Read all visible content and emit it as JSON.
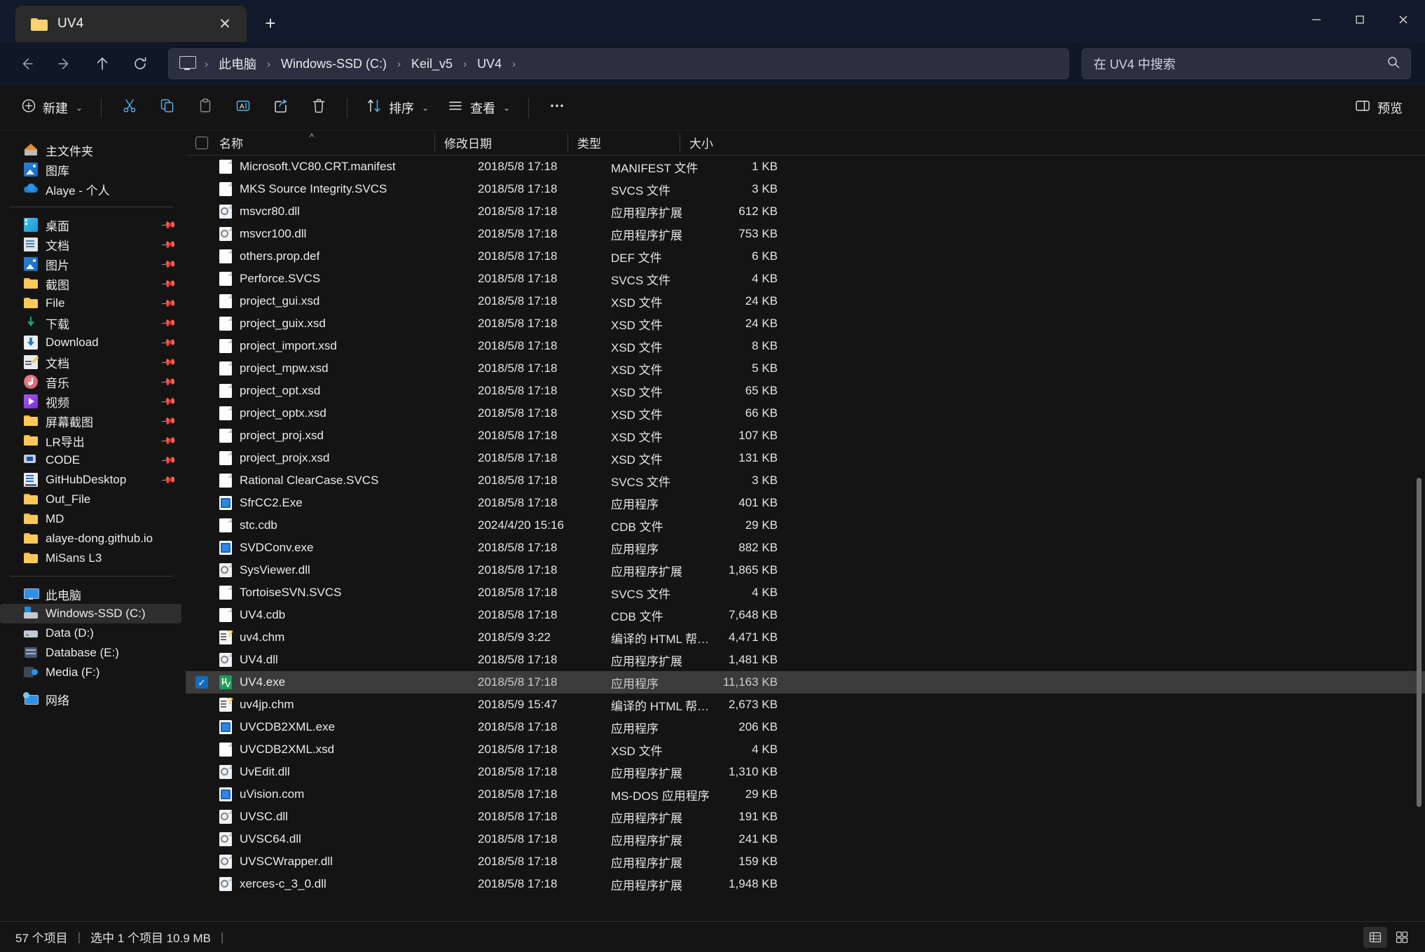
{
  "window": {
    "tab_title": "UV4",
    "tab_close_glyph": "✕",
    "new_tab_glyph": "+",
    "minimize_label": "最小化",
    "maximize_label": "最大化",
    "close_label": "关闭"
  },
  "addressbar": {
    "back_label": "返回",
    "forward_label": "前进",
    "up_label": "向上",
    "refresh_label": "刷新",
    "breadcrumbs": [
      "此电脑",
      "Windows-SSD (C:)",
      "Keil_v5",
      "UV4"
    ],
    "separator": "›",
    "search_placeholder": "在 UV4 中搜索"
  },
  "toolbar": {
    "new_label": "新建",
    "cut_label": "剪切",
    "copy_label": "复制",
    "paste_label": "粘贴",
    "rename_label": "重命名",
    "share_label": "共享",
    "delete_label": "删除",
    "sort_label": "排序",
    "view_label": "查看",
    "more_label": "查看更多",
    "preview_label": "预览",
    "chevron": "⌄"
  },
  "sidebar": {
    "groups": [
      {
        "items": [
          {
            "label": "主文件夹",
            "icon": "home-icon",
            "pinned": false
          },
          {
            "label": "图库",
            "icon": "gallery-icon",
            "pinned": false
          },
          {
            "label": "Alaye - 个人",
            "icon": "onedrive-icon",
            "pinned": false
          }
        ]
      },
      {
        "items": [
          {
            "label": "桌面",
            "icon": "desktop-icon",
            "pinned": true
          },
          {
            "label": "文档",
            "icon": "documents-icon",
            "pinned": true
          },
          {
            "label": "图片",
            "icon": "pictures-icon",
            "pinned": true
          },
          {
            "label": "截图",
            "icon": "folder-icon",
            "pinned": true
          },
          {
            "label": "File",
            "icon": "folder-icon",
            "pinned": true
          },
          {
            "label": "下载",
            "icon": "downloads-arrow-icon",
            "pinned": true
          },
          {
            "label": "Download",
            "icon": "download-box-icon",
            "pinned": true
          },
          {
            "label": "文档",
            "icon": "documents-edit-icon",
            "pinned": true
          },
          {
            "label": "音乐",
            "icon": "music-icon",
            "pinned": true
          },
          {
            "label": "视频",
            "icon": "video-icon",
            "pinned": true
          },
          {
            "label": "屏幕截图",
            "icon": "folder-icon",
            "pinned": true
          },
          {
            "label": "LR导出",
            "icon": "folder-icon",
            "pinned": true
          },
          {
            "label": "CODE",
            "icon": "code-icon",
            "pinned": true
          },
          {
            "label": "GitHubDesktop",
            "icon": "githubdesktop-icon",
            "pinned": true
          },
          {
            "label": "Out_File",
            "icon": "folder-icon",
            "pinned": false
          },
          {
            "label": "MD",
            "icon": "folder-icon",
            "pinned": false
          },
          {
            "label": "alaye-dong.github.io",
            "icon": "folder-icon",
            "pinned": false
          },
          {
            "label": "MiSans L3",
            "icon": "folder-icon",
            "pinned": false
          }
        ]
      },
      {
        "items": [
          {
            "label": "此电脑",
            "icon": "this-pc-icon",
            "pinned": false
          },
          {
            "label": "Windows-SSD (C:)",
            "icon": "windows-drive-icon",
            "pinned": false,
            "selected": true
          },
          {
            "label": "Data (D:)",
            "icon": "drive-icon",
            "pinned": false
          },
          {
            "label": "Database (E:)",
            "icon": "database-drive-icon",
            "pinned": false
          },
          {
            "label": "Media (F:)",
            "icon": "media-drive-icon",
            "pinned": false
          }
        ]
      },
      {
        "items": [
          {
            "label": "网络",
            "icon": "network-icon",
            "pinned": false
          }
        ]
      }
    ]
  },
  "filelist": {
    "columns": {
      "name": "名称",
      "date": "修改日期",
      "type": "类型",
      "size": "大小"
    },
    "sort_indicator": "^",
    "rows": [
      {
        "name": "Microsoft.VC80.CRT.manifest",
        "date": "2018/5/8 17:18",
        "type": "MANIFEST 文件",
        "size": "1 KB",
        "icon": "file-blank-icon"
      },
      {
        "name": "MKS Source Integrity.SVCS",
        "date": "2018/5/8 17:18",
        "type": "SVCS 文件",
        "size": "3 KB",
        "icon": "file-blank-icon"
      },
      {
        "name": "msvcr80.dll",
        "date": "2018/5/8 17:18",
        "type": "应用程序扩展",
        "size": "612 KB",
        "icon": "file-dll-icon"
      },
      {
        "name": "msvcr100.dll",
        "date": "2018/5/8 17:18",
        "type": "应用程序扩展",
        "size": "753 KB",
        "icon": "file-dll-icon"
      },
      {
        "name": "others.prop.def",
        "date": "2018/5/8 17:18",
        "type": "DEF 文件",
        "size": "6 KB",
        "icon": "file-blank-icon"
      },
      {
        "name": "Perforce.SVCS",
        "date": "2018/5/8 17:18",
        "type": "SVCS 文件",
        "size": "4 KB",
        "icon": "file-blank-icon"
      },
      {
        "name": "project_gui.xsd",
        "date": "2018/5/8 17:18",
        "type": "XSD 文件",
        "size": "24 KB",
        "icon": "file-blank-icon"
      },
      {
        "name": "project_guix.xsd",
        "date": "2018/5/8 17:18",
        "type": "XSD 文件",
        "size": "24 KB",
        "icon": "file-blank-icon"
      },
      {
        "name": "project_import.xsd",
        "date": "2018/5/8 17:18",
        "type": "XSD 文件",
        "size": "8 KB",
        "icon": "file-blank-icon"
      },
      {
        "name": "project_mpw.xsd",
        "date": "2018/5/8 17:18",
        "type": "XSD 文件",
        "size": "5 KB",
        "icon": "file-blank-icon"
      },
      {
        "name": "project_opt.xsd",
        "date": "2018/5/8 17:18",
        "type": "XSD 文件",
        "size": "65 KB",
        "icon": "file-blank-icon"
      },
      {
        "name": "project_optx.xsd",
        "date": "2018/5/8 17:18",
        "type": "XSD 文件",
        "size": "66 KB",
        "icon": "file-blank-icon"
      },
      {
        "name": "project_proj.xsd",
        "date": "2018/5/8 17:18",
        "type": "XSD 文件",
        "size": "107 KB",
        "icon": "file-blank-icon"
      },
      {
        "name": "project_projx.xsd",
        "date": "2018/5/8 17:18",
        "type": "XSD 文件",
        "size": "131 KB",
        "icon": "file-blank-icon"
      },
      {
        "name": "Rational ClearCase.SVCS",
        "date": "2018/5/8 17:18",
        "type": "SVCS 文件",
        "size": "3 KB",
        "icon": "file-blank-icon"
      },
      {
        "name": "SfrCC2.Exe",
        "date": "2018/5/8 17:18",
        "type": "应用程序",
        "size": "401 KB",
        "icon": "file-exe-icon"
      },
      {
        "name": "stc.cdb",
        "date": "2024/4/20 15:16",
        "type": "CDB 文件",
        "size": "29 KB",
        "icon": "file-blank-icon"
      },
      {
        "name": "SVDConv.exe",
        "date": "2018/5/8 17:18",
        "type": "应用程序",
        "size": "882 KB",
        "icon": "file-exe-icon"
      },
      {
        "name": "SysViewer.dll",
        "date": "2018/5/8 17:18",
        "type": "应用程序扩展",
        "size": "1,865 KB",
        "icon": "file-dll-icon"
      },
      {
        "name": "TortoiseSVN.SVCS",
        "date": "2018/5/8 17:18",
        "type": "SVCS 文件",
        "size": "4 KB",
        "icon": "file-blank-icon"
      },
      {
        "name": "UV4.cdb",
        "date": "2018/5/8 17:18",
        "type": "CDB 文件",
        "size": "7,648 KB",
        "icon": "file-blank-icon"
      },
      {
        "name": "uv4.chm",
        "date": "2018/5/9 3:22",
        "type": "编译的 HTML 帮助文...",
        "size": "4,471 KB",
        "icon": "file-chm-icon"
      },
      {
        "name": "UV4.dll",
        "date": "2018/5/8 17:18",
        "type": "应用程序扩展",
        "size": "1,481 KB",
        "icon": "file-dll-icon"
      },
      {
        "name": "UV4.exe",
        "date": "2018/5/8 17:18",
        "type": "应用程序",
        "size": "11,163 KB",
        "icon": "uvision-icon",
        "selected": true
      },
      {
        "name": "uv4jp.chm",
        "date": "2018/5/9 15:47",
        "type": "编译的 HTML 帮助文...",
        "size": "2,673 KB",
        "icon": "file-chm-icon"
      },
      {
        "name": "UVCDB2XML.exe",
        "date": "2018/5/8 17:18",
        "type": "应用程序",
        "size": "206 KB",
        "icon": "file-exe-icon"
      },
      {
        "name": "UVCDB2XML.xsd",
        "date": "2018/5/8 17:18",
        "type": "XSD 文件",
        "size": "4 KB",
        "icon": "file-blank-icon"
      },
      {
        "name": "UvEdit.dll",
        "date": "2018/5/8 17:18",
        "type": "应用程序扩展",
        "size": "1,310 KB",
        "icon": "file-dll-icon"
      },
      {
        "name": "uVision.com",
        "date": "2018/5/8 17:18",
        "type": "MS-DOS 应用程序",
        "size": "29 KB",
        "icon": "file-exe-icon"
      },
      {
        "name": "UVSC.dll",
        "date": "2018/5/8 17:18",
        "type": "应用程序扩展",
        "size": "191 KB",
        "icon": "file-dll-icon"
      },
      {
        "name": "UVSC64.dll",
        "date": "2018/5/8 17:18",
        "type": "应用程序扩展",
        "size": "241 KB",
        "icon": "file-dll-icon"
      },
      {
        "name": "UVSCWrapper.dll",
        "date": "2018/5/8 17:18",
        "type": "应用程序扩展",
        "size": "159 KB",
        "icon": "file-dll-icon"
      },
      {
        "name": "xerces-c_3_0.dll",
        "date": "2018/5/8 17:18",
        "type": "应用程序扩展",
        "size": "1,948 KB",
        "icon": "file-dll-icon"
      }
    ]
  },
  "statusbar": {
    "item_count": "57 个项目",
    "separator1": "|",
    "selection": "选中 1 个项目  10.9 MB",
    "separator2": "|",
    "details_view_label": "详细信息视图",
    "large_icons_view_label": "大图标视图"
  }
}
